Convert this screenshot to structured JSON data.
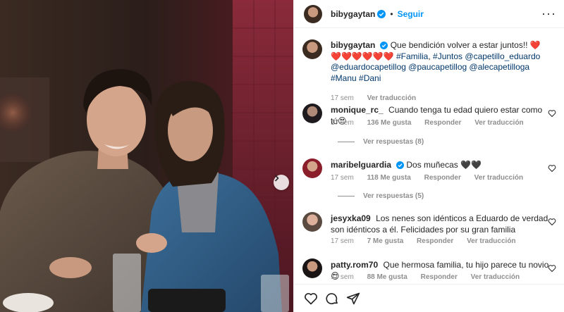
{
  "header": {
    "username": "bibygaytan",
    "separator": "•",
    "follow_label": "Seguir",
    "more_label": "···"
  },
  "caption": {
    "username": "bibygaytan",
    "text_plain": "Que bendición volver a estar juntos!! ❤️❤️❤️❤️❤️❤️❤️",
    "hashtag1": "#Familia",
    "hashtag2": "#Juntos",
    "mention1": "@capetillo_eduardo",
    "mention2": "@eduardocapetillog",
    "mention3": "@paucapetillog",
    "mention4": "@alecapetilloga",
    "hashtag3": "#Manu",
    "hashtag4": "#Dani",
    "time": "17 sem",
    "translate": "Ver traducción"
  },
  "comments": [
    {
      "username": "monique_rc_",
      "text": "Cuando tenga tu edad quiero estar como tú😍",
      "time": "17 sem",
      "likes": "136 Me gusta",
      "reply": "Responder",
      "translate": "Ver traducción",
      "replies": "Ver respuestas (8)"
    },
    {
      "username": "maribelguardia",
      "text": "Dos muñecas 🖤🖤",
      "time": "17 sem",
      "likes": "118 Me gusta",
      "reply": "Responder",
      "translate": "Ver traducción",
      "replies": "Ver respuestas (5)"
    },
    {
      "username": "jesyxka09",
      "text": "Los nenes son idénticos a Eduardo de verdad son idénticos a él. Felicidades por su gran familia",
      "time": "17 sem",
      "likes": "7 Me gusta",
      "reply": "Responder",
      "translate": "Ver traducción"
    },
    {
      "username": "patty.rom70",
      "text": "Que hermosa familia, tu hijo parece tu novio 😍",
      "time": "17 sem",
      "likes": "88 Me gusta",
      "reply": "Responder",
      "translate": "Ver traducción"
    }
  ],
  "icons": {
    "verified": "verified-badge-icon",
    "like": "heart-icon",
    "comment": "comment-icon",
    "share": "paper-plane-icon",
    "next": "chevron-right-icon"
  },
  "colors": {
    "accent": "#0095f6",
    "link": "#00376b",
    "muted": "#8e8e8e",
    "text": "#262626"
  }
}
